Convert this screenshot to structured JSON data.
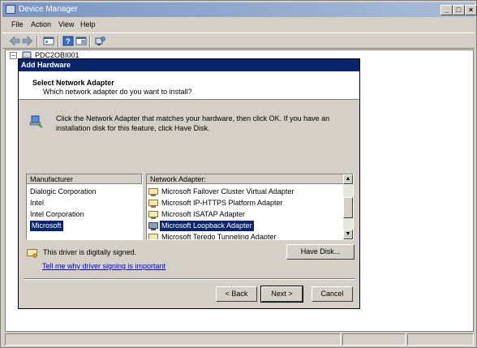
{
  "window": {
    "title": "Device Manager"
  },
  "menu": {
    "items": [
      "File",
      "Action",
      "View",
      "Help"
    ]
  },
  "tree": {
    "root": "PDC2OBI001"
  },
  "dialog": {
    "title": "Add Hardware",
    "heading": "Select Network Adapter",
    "subheading": "Which network adapter do you want to install?",
    "instructions": "Click the Network Adapter that matches your hardware, then click OK. If you have an installation disk for this feature, click Have Disk.",
    "manufacturer_header": "Manufacturer",
    "manufacturers": [
      "Dialogic Corporation",
      "Intel",
      "Intel Corporation",
      "Microsoft"
    ],
    "selected_manufacturer": "Microsoft",
    "adapter_header": "Network Adapter:",
    "adapters": [
      "Microsoft Failover Cluster Virtual Adapter",
      "Microsoft IP-HTTPS Platform Adapter",
      "Microsoft ISATAP Adapter",
      "Microsoft Loopback Adapter",
      "Microsoft Teredo Tunneling Adapter"
    ],
    "selected_adapter": "Microsoft Loopback Adapter",
    "signed_text": "This driver is digitally signed.",
    "signing_link": "Tell me why driver signing is important",
    "have_disk_label": "Have Disk...",
    "back_label": "< Back",
    "next_label": "Next >",
    "cancel_label": "Cancel"
  },
  "colors": {
    "selection": "#0a246a",
    "link": "#0000cc",
    "titlebar": "#7a96c2"
  }
}
